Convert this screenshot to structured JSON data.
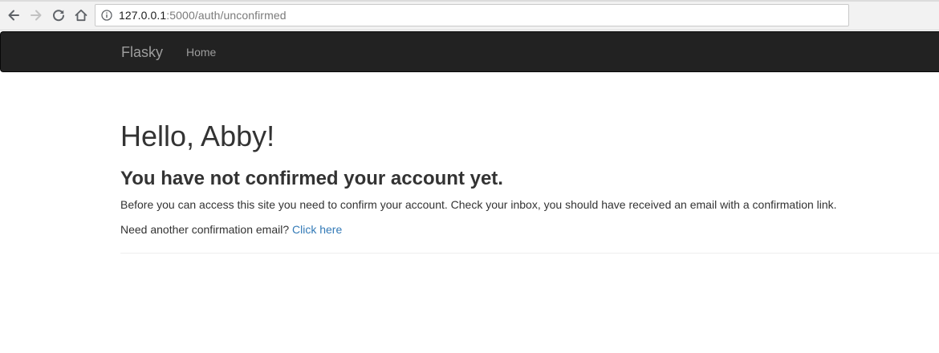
{
  "browser": {
    "url_host": "127.0.0.1",
    "url_path": ":5000/auth/unconfirmed",
    "icons": {
      "back": "arrow-left-icon",
      "forward": "arrow-right-icon",
      "reload": "reload-icon",
      "home": "home-icon",
      "site_info": "info-icon"
    }
  },
  "navbar": {
    "brand": "Flasky",
    "links": [
      {
        "label": "Home"
      }
    ],
    "background": "#222222",
    "text_color": "#9d9d9d"
  },
  "content": {
    "greeting": "Hello, Abby!",
    "subheading": "You have not confirmed your account yet.",
    "instructions": "Before you can access this site you need to confirm your account. Check your inbox, you should have received an email with a confirmation link.",
    "resend_prompt": "Need another confirmation email?",
    "resend_link": "Click here",
    "link_color": "#337ab7",
    "text_color": "#333333"
  }
}
